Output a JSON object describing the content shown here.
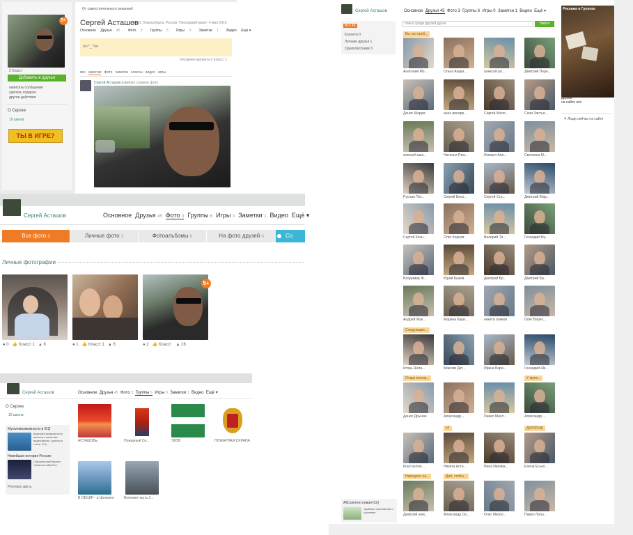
{
  "panel1": {
    "notice": "От самостоятельного решения!",
    "name": "Сергей Асташов",
    "meta": "46 лет, Новосибирск, Россия. Последний визит: 4 мая 2015",
    "tabs": [
      "Основное",
      "Друзья",
      "Фото",
      "Группы",
      "Игры",
      "Заметки",
      "Видео",
      "Ещё ▾"
    ],
    "tab_counts": [
      "",
      "45",
      "3",
      "6",
      "0",
      "1",
      "",
      ""
    ],
    "status_text": "ин^_^ин",
    "status_footer": "0 Комментировать   0  Класс! 1",
    "add_friend": "Добавить в друзья",
    "actions": [
      "написать сообщение",
      "сделать подарок",
      "другие действия"
    ],
    "photo_counts": "2  Класс!",
    "about_label": "О Сергее",
    "school": "10 школа",
    "promo": "ТЫ В ИГРЕ?",
    "feed_tabs": [
      "все",
      "заметки",
      "фото",
      "заметки",
      "классы",
      "видео",
      "игры"
    ],
    "feed_author": "Сергей Асташов",
    "feed_action": "изменил главное фото",
    "badge": "5+"
  },
  "panel2": {
    "name": "Сергей Асташов",
    "nav": [
      {
        "label": "Основное",
        "count": ""
      },
      {
        "label": "Друзья",
        "count": "45"
      },
      {
        "label": "Фото",
        "count": "3"
      },
      {
        "label": "Группы",
        "count": "6"
      },
      {
        "label": "Игры",
        "count": "0"
      },
      {
        "label": "Заметки",
        "count": "1"
      },
      {
        "label": "Видео",
        "count": ""
      },
      {
        "label": "Ещё ▾",
        "count": ""
      }
    ],
    "tabs": [
      {
        "label": "Все фото",
        "count": "3"
      },
      {
        "label": "Личные фото",
        "count": "3"
      },
      {
        "label": "Фотоальбомы",
        "count": "0"
      },
      {
        "label": "На фото друзей",
        "count": "0"
      },
      {
        "label": "Со",
        "count": ""
      }
    ],
    "section_title": "Личные фотографии",
    "photos": [
      {
        "comments": "0",
        "class_label": "Класс!",
        "class_count": "1",
        "likes": "8"
      },
      {
        "comments": "1",
        "class_label": "Класс!",
        "class_count": "1",
        "likes": "6"
      },
      {
        "comments": "2",
        "class_label": "Класс!",
        "class_count": "",
        "likes": "26"
      }
    ],
    "badge": "5+"
  },
  "panel3": {
    "name": "Сергей Асташов",
    "nav": [
      "Основное",
      "Друзья",
      "Фото",
      "Группы",
      "Игры",
      "Заметки",
      "Видео",
      "Ещё ▾"
    ],
    "nav_counts": [
      "",
      "45",
      "3",
      "6",
      "0",
      "1",
      "",
      ""
    ],
    "about": "О Сергее",
    "school": "10 школа",
    "ad1_title": "Мультивозможности в ICQ",
    "ad1_text": "Широкие возможности высокого качества: видеозвонки, группы в стиле ICQ",
    "ad2_title": "Новейшая история России",
    "ad2_text": "Специальный проект «Новости Mail.Ru»",
    "ad_footer": "Реклама здесь",
    "groups": [
      "АСТАШОВы",
      "Пожарный Си...",
      "ЭКУВ",
      "ПОЖАРНАЯ ОХРАНА",
      "В ОБСИР - в Шилкино",
      "Военная часть 2..."
    ]
  },
  "panel4": {
    "name": "Сергей Асташов",
    "nav": [
      "Основное",
      "Друзья 45",
      "Фото 3",
      "Группы 6",
      "Игры 0",
      "Заметки 1",
      "Видео",
      "Ещё ▾"
    ],
    "search_placeholder": "поиск среди друзей друга",
    "search_button": "Найти",
    "left_items": [
      "Все 45",
      "Коллеги 0",
      "Лучшие друзья 1",
      "Одноклассники 3"
    ],
    "ad_header": "Реклама в Группах",
    "right_text1": "Прямо сейчас никого из",
    "right_text2": "друзей",
    "right_text3": "на сайте нет.",
    "right_text4": "Люди сейчас на сайте",
    "bottom_ad_title": "Абсолютно новая ICQ",
    "bottom_ad_text": "Удобные приложения с группами.",
    "section_tags": [
      "Вы это проб...",
      "Следующие...",
      "Очарк полож...",
      "У меня...",
      "5!!",
      "ДОРОГИЕ",
      "Народное на...",
      "Дай, чтобы..."
    ],
    "friends": [
      "Анатолий Мо...",
      "Ольга Акари...",
      "алексей ро...",
      "Дмитрий Пере...",
      "Денис Шарум",
      "анна ринорр...",
      "Сергей Мало...",
      "Саня Застья...",
      "алексей шко...",
      "Наталья Пем...",
      "Исмаил Але...",
      "Светлана М...",
      "Руслан Пот...",
      "Сергей Белз...",
      "Сергей Стр...",
      "Дмитрий Жар...",
      "Сергей Ксен...",
      "Олег Корнев",
      "Валерий Ти...",
      "Геннадий Му...",
      "Владимир Ж...",
      "Юрий Быков",
      "Дмитрий Бр...",
      "Дмитрий Бр...",
      "Андрей Жук...",
      "Марина Кари...",
      "никита ловков",
      "Олег Бирло...",
      "Игорь Шата...",
      "Максим Дет...",
      "Ирина Бари...",
      "Геннадий Шк...",
      "Денис Дрычин",
      "Александр...",
      "Павел Масл...",
      "Александр ...",
      "Константин ...",
      "Никита Аста...",
      "Инна Ивлева...",
      "Елена Есько...",
      "Дмитрий нем...",
      "Александр Св...",
      "Олег Митро...",
      "Павел Латы..."
    ]
  }
}
